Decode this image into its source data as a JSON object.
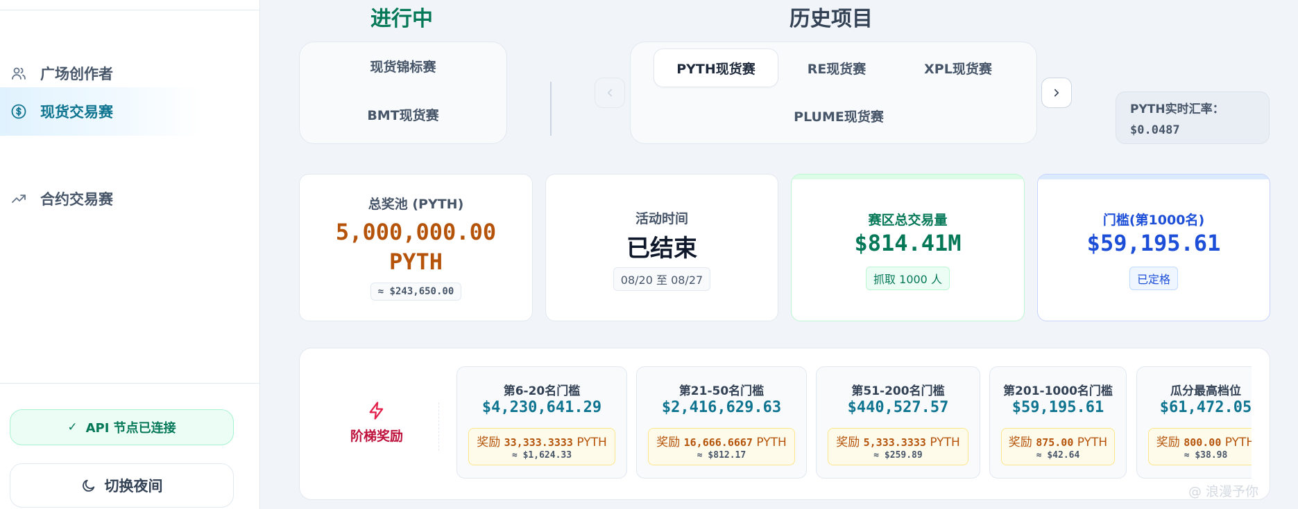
{
  "sidebar": {
    "items": [
      {
        "label": "广场创作者",
        "icon": "users-icon"
      },
      {
        "label": "现货交易赛",
        "icon": "dollar-circle-icon"
      },
      {
        "label": "合约交易赛",
        "icon": "trend-up-icon"
      }
    ],
    "active_item": "现货交易赛",
    "api_status": "API 节点已连接",
    "theme_toggle": "切换夜间"
  },
  "sections": {
    "ongoing_title": "进行中",
    "history_title": "历史项目"
  },
  "ongoing_tabs": [
    "现货锦标赛",
    "BMT现货赛"
  ],
  "history_tabs": [
    "PYTH现货赛",
    "RE现货赛",
    "XPL现货赛",
    "PLUME现货赛"
  ],
  "selected_tab": "PYTH现货赛",
  "rate": {
    "label": "PYTH实时汇率：",
    "value": "$0.0487"
  },
  "stats": {
    "pool": {
      "label": "总奖池 (PYTH)",
      "amount": "5,000,000.00",
      "unit": "PYTH",
      "usd": "≈ $243,650.00"
    },
    "time": {
      "label": "活动时间",
      "value": "已结束",
      "range": "08/20 至 08/27"
    },
    "volume": {
      "label": "赛区总交易量",
      "value": "$814.41M",
      "note": "抓取 1000 人"
    },
    "threshold": {
      "label": "门槛(第1000名)",
      "value": "$59,195.61",
      "note": "已定格"
    }
  },
  "tiers": {
    "title": "阶梯奖励",
    "reward_prefix": "奖励",
    "reward_unit": "PYTH",
    "items": [
      {
        "name": "第6-20名门槛",
        "value": "$4,230,641.29",
        "reward": "33,333.3333",
        "usd": "≈ $1,624.33"
      },
      {
        "name": "第21-50名门槛",
        "value": "$2,416,629.63",
        "reward": "16,666.6667",
        "usd": "≈ $812.17"
      },
      {
        "name": "第51-200名门槛",
        "value": "$440,527.57",
        "reward": "5,333.3333",
        "usd": "≈ $259.89"
      },
      {
        "name": "第201-1000名门槛",
        "value": "$59,195.61",
        "reward": "875.00",
        "usd": "≈ $42.64"
      },
      {
        "name": "瓜分最高档位",
        "value": "$61,472.05",
        "reward": "800.00",
        "usd": "≈ $38.98"
      }
    ]
  },
  "watermark": "@ 浪漫予你",
  "colors": {
    "accent": "#0e7490",
    "ongoing": "#047857",
    "pool_amount": "#b45309",
    "threshold": "#1d4ed8",
    "tier_title": "#be123c"
  }
}
